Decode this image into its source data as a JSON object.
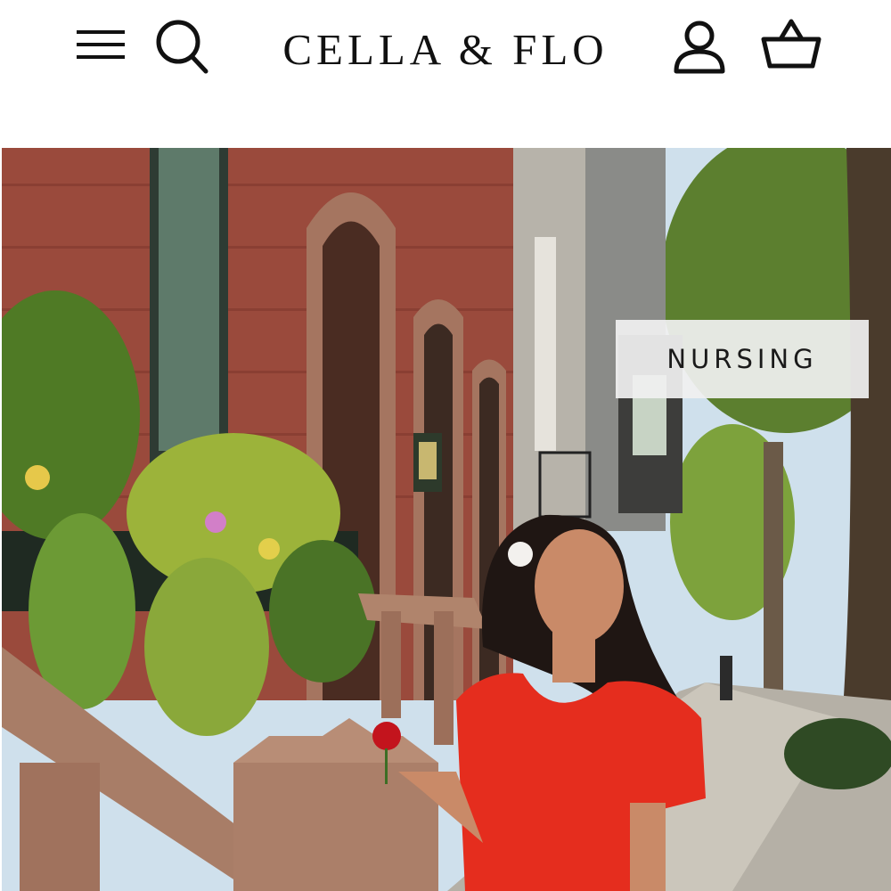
{
  "header": {
    "logo": "CELLA & FLO",
    "menu_icon": "hamburger-menu-icon",
    "search_icon": "search-icon",
    "account_icon": "account-icon",
    "cart_icon": "basket-icon"
  },
  "hero": {
    "badge": "NURSING",
    "image": "woman-in-red-dress-on-brownstone-stoop",
    "colors": {
      "brick": "#9a4a3c",
      "stone": "#a57560",
      "dress": "#e52d1e",
      "foliage": "#6b8f2a",
      "sky": "#c9dcea"
    }
  }
}
